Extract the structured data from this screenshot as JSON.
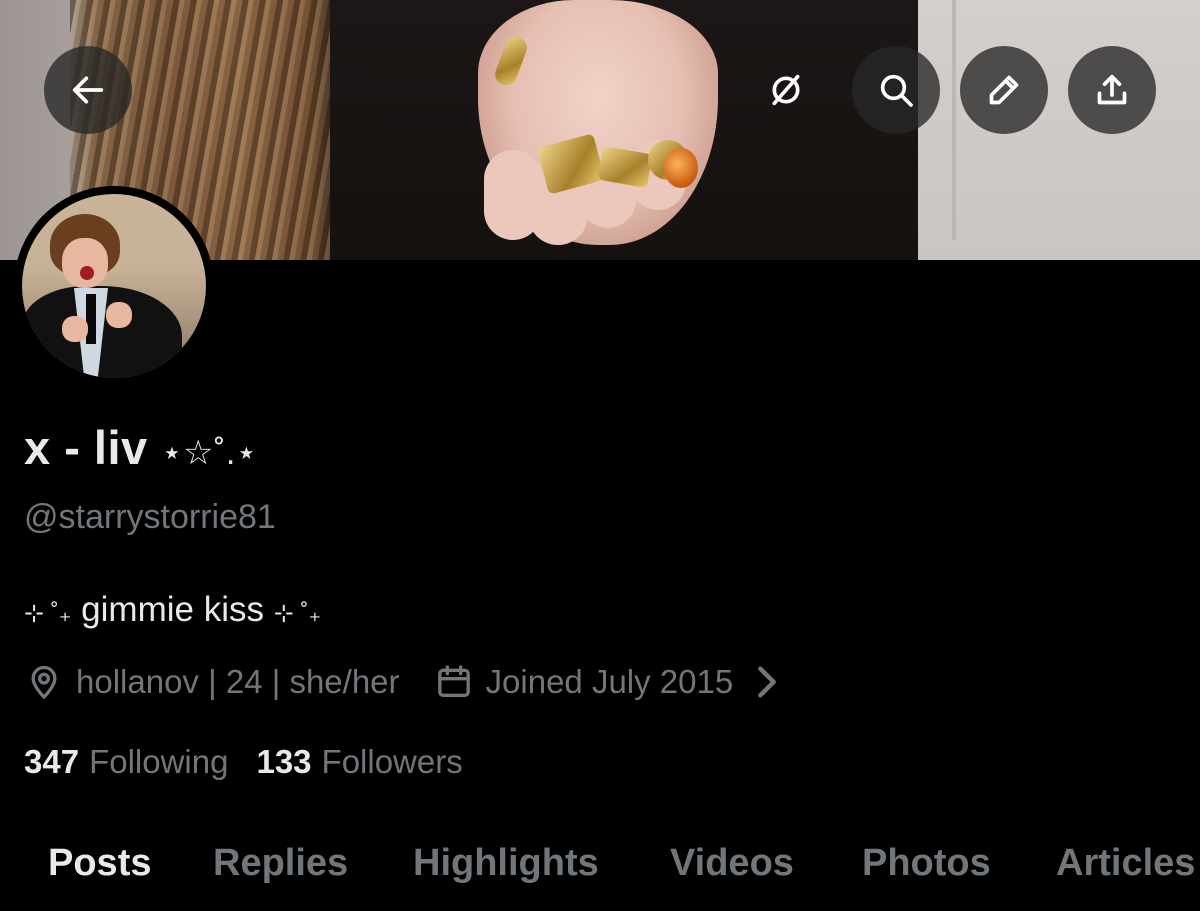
{
  "profile": {
    "display_name": "x - liv",
    "name_decoration": "⋆☆˚.⋆",
    "handle": "@starrystorrie81",
    "bio_prefix": "⊹ ˚₊",
    "bio_text": "gimmie kiss",
    "bio_suffix": "⊹ ˚₊",
    "location": "hollanov | 24 | she/her",
    "joined": "Joined July 2015"
  },
  "stats": {
    "following_count": "347",
    "following_label": "Following",
    "followers_count": "133",
    "followers_label": "Followers"
  },
  "tabs": {
    "posts": "Posts",
    "replies": "Replies",
    "highlights": "Highlights",
    "videos": "Videos",
    "photos": "Photos",
    "articles": "Articles"
  },
  "icons": {
    "back": "arrow-left-icon",
    "grok": "slashed-circle-icon",
    "search": "search-icon",
    "edit": "pencil-icon",
    "share": "share-icon",
    "location": "location-pin-icon",
    "calendar": "calendar-icon",
    "chevron": "chevron-right-icon"
  },
  "colors": {
    "background": "#000000",
    "primary_text": "#e7e9ea",
    "secondary_text": "#71767b",
    "button_bg": "rgba(40,40,40,0.78)"
  }
}
